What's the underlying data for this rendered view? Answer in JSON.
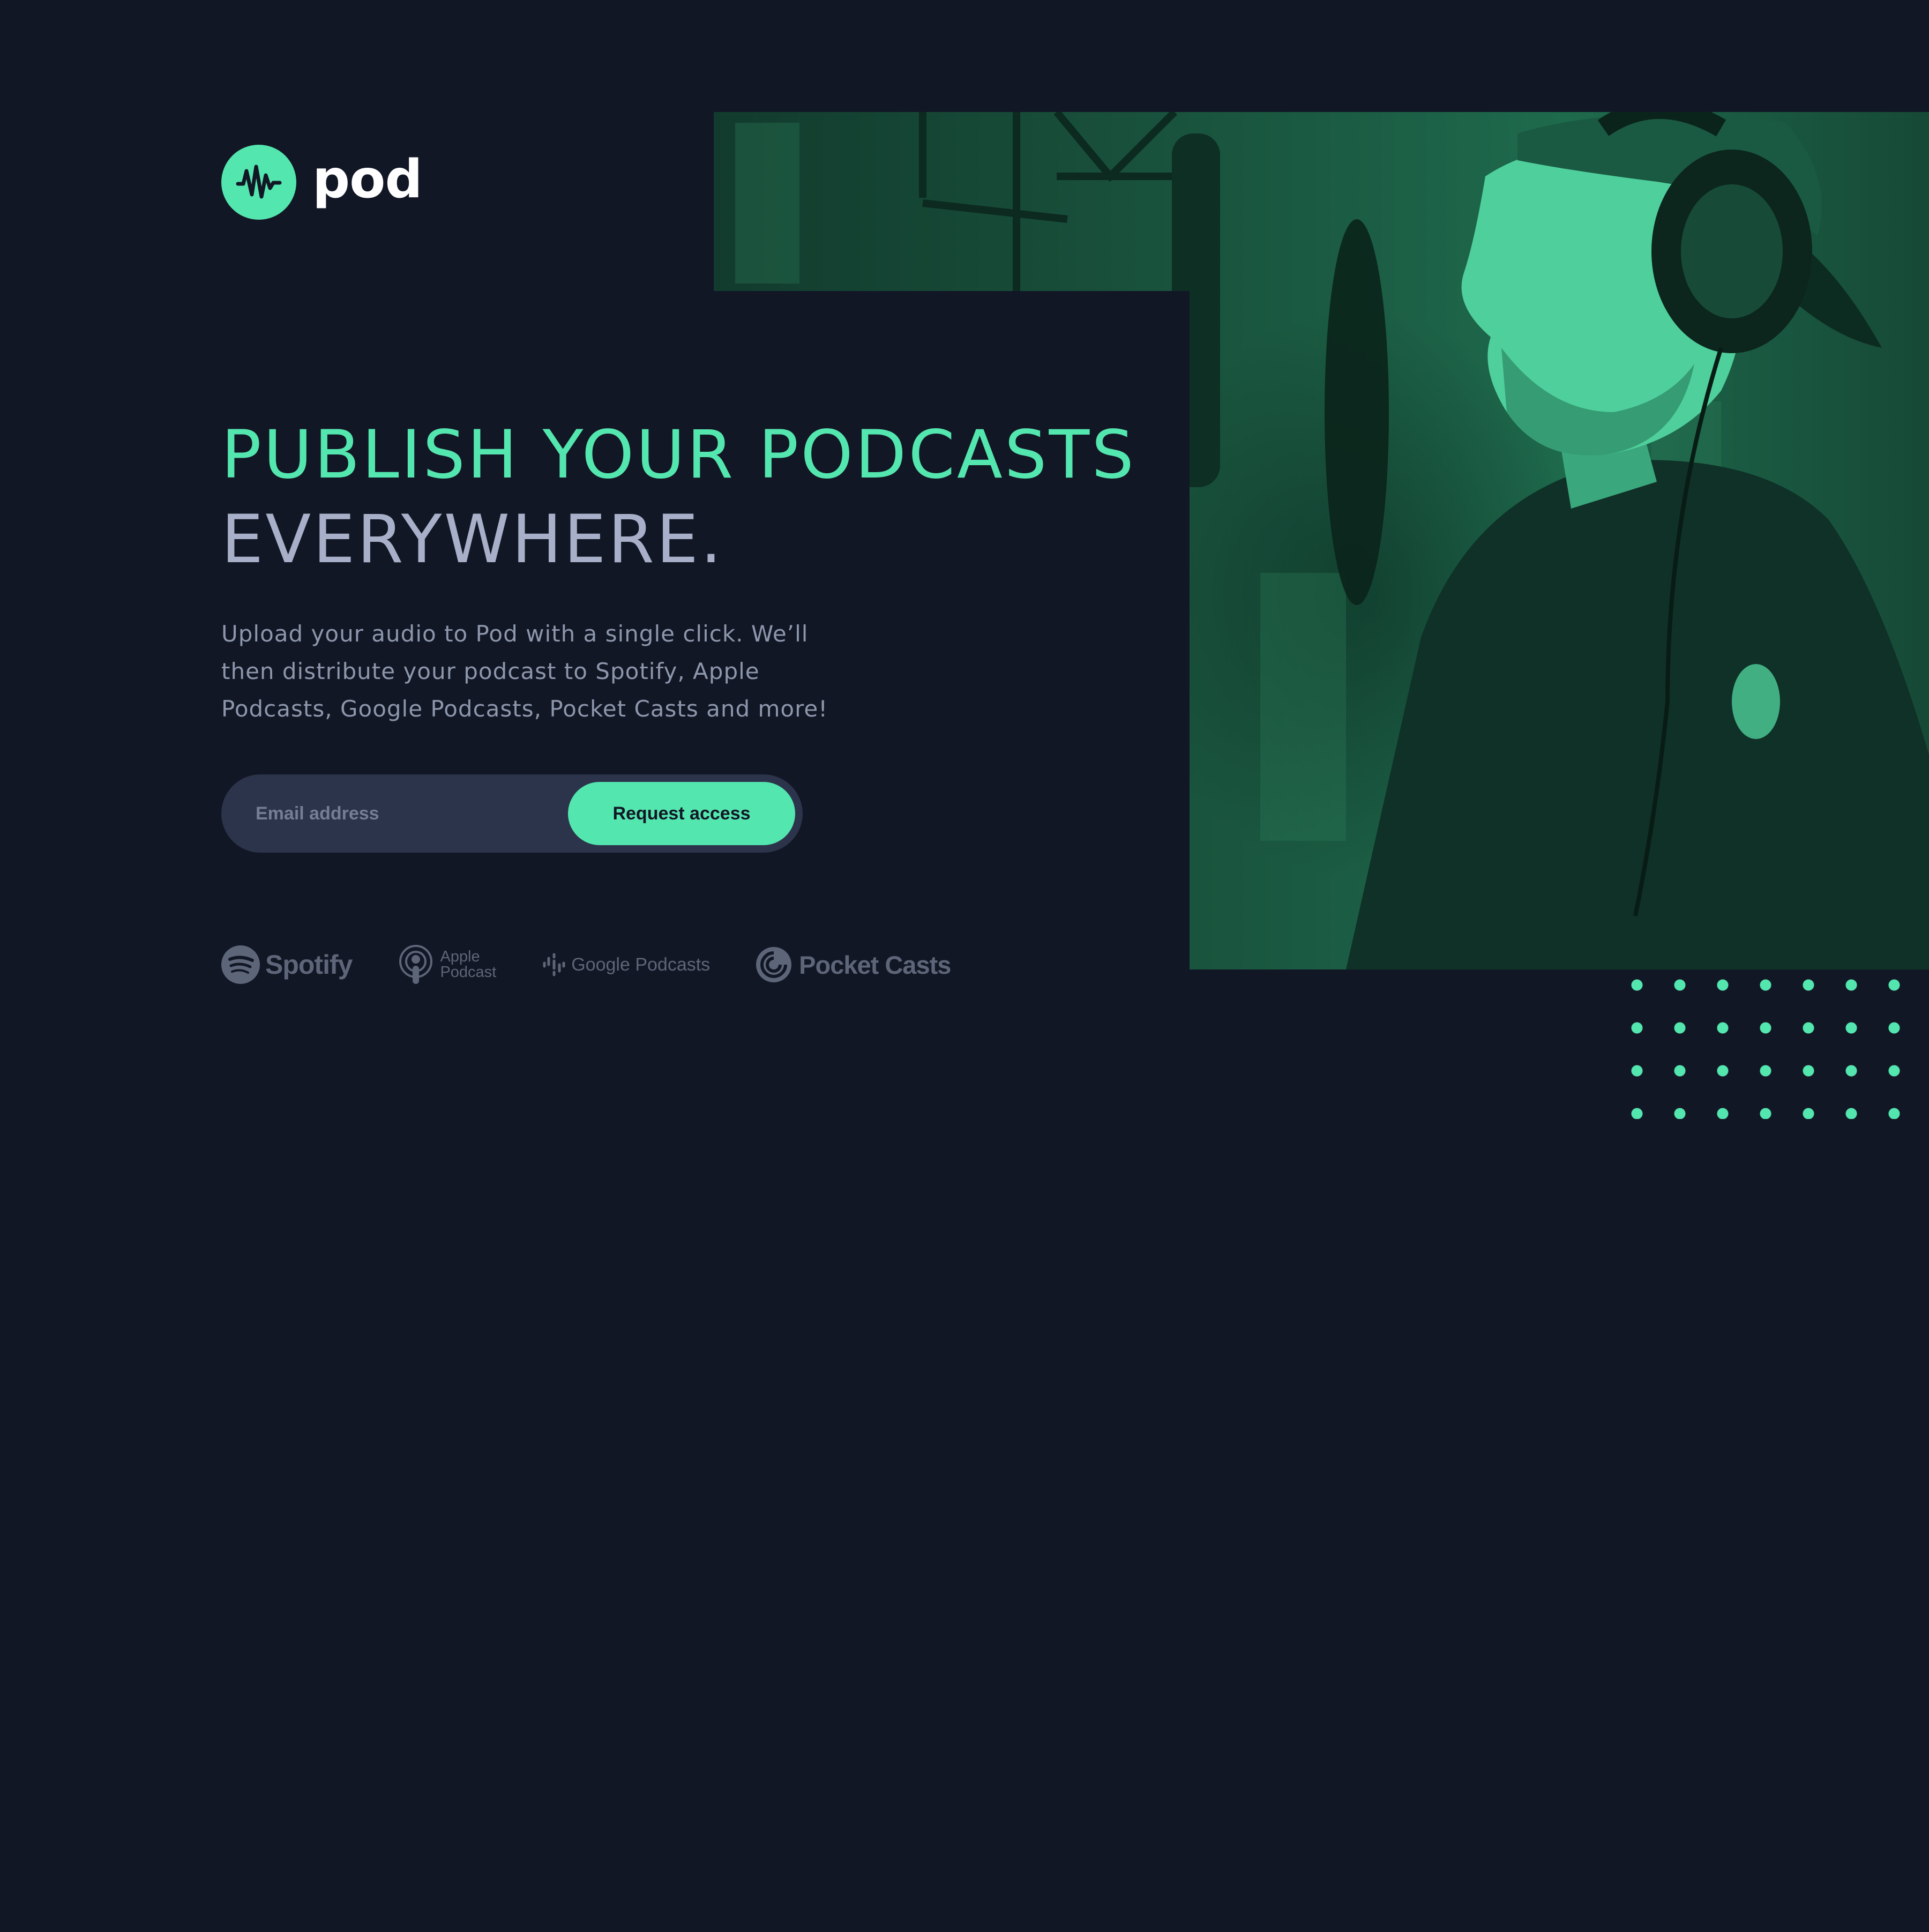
{
  "brand": {
    "name": "pod",
    "icon": "waveform-icon",
    "accent_color": "#54e6af",
    "background_color": "#121725"
  },
  "hero": {
    "headline_accent": "PUBLISH YOUR PODCASTS",
    "headline_plain": "EVERYWHERE.",
    "description": "Upload your audio to Pod with a single click. We’ll then distribute your podcast to Spotify, Apple Podcasts, Google Podcasts, Pocket Casts and more!",
    "image": "podcaster-with-headphones-at-microphone"
  },
  "form": {
    "email_placeholder": "Email address",
    "email_value": "",
    "button_label": "Request access"
  },
  "platforms": [
    {
      "name": "Spotify",
      "icon": "spotify-icon"
    },
    {
      "name_line1": "Apple",
      "name_line2": "Podcast",
      "icon": "apple-podcasts-icon"
    },
    {
      "name": "Google Podcasts",
      "icon": "google-podcasts-icon"
    },
    {
      "name": "Pocket Casts",
      "icon": "pocket-casts-icon"
    }
  ],
  "decoration": {
    "pattern": "dot-grid",
    "dot_color": "#54e6af"
  }
}
